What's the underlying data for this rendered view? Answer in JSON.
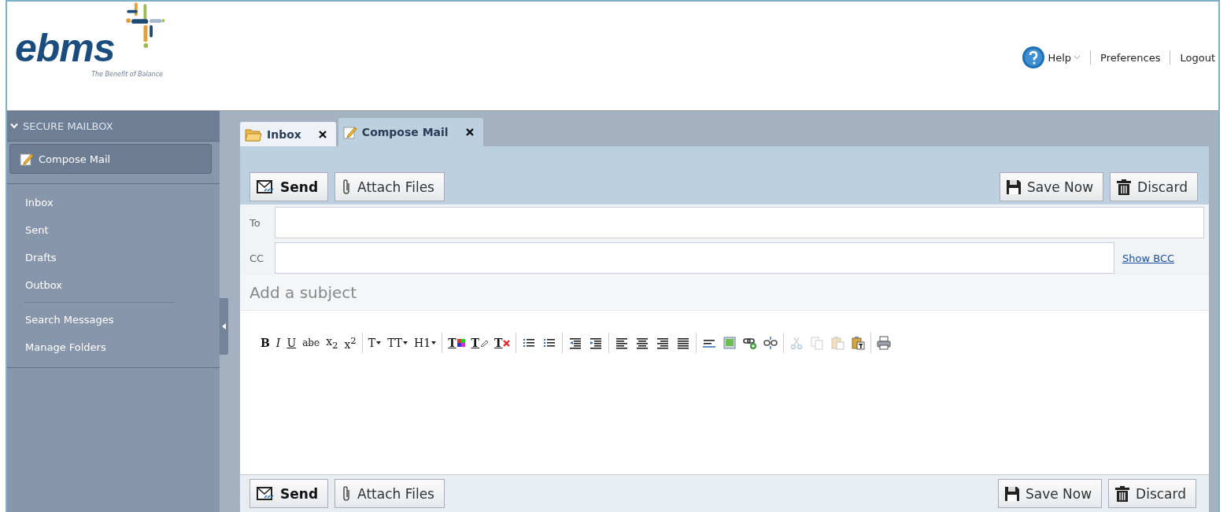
{
  "logo": {
    "name": "ebms",
    "tagline": "The Benefit of Balance"
  },
  "header_links": [
    {
      "kind": "help",
      "label": "Help"
    },
    {
      "kind": "link",
      "label": "Preferences"
    },
    {
      "kind": "link",
      "label": "Logout"
    }
  ],
  "sidebar": {
    "title": "SECURE MAILBOX",
    "expanded": true,
    "compose_button": "Compose Mail",
    "groups": [
      [
        {
          "label": "Inbox"
        },
        {
          "label": "Sent"
        },
        {
          "label": "Drafts"
        },
        {
          "label": "Outbox"
        }
      ],
      [
        {
          "label": "Search Messages"
        },
        {
          "label": "Manage Folders"
        }
      ]
    ]
  },
  "tabs": [
    {
      "label": "Inbox",
      "kind": "folder",
      "selected": false
    },
    {
      "label": "Compose Mail",
      "kind": "compose",
      "selected": true
    }
  ],
  "toolbars": [
    {
      "left": [
        {
          "label": "Send",
          "kind": "send"
        },
        {
          "label": "Attach Files",
          "kind": "attach"
        }
      ],
      "right": [
        {
          "label": "Save Now",
          "kind": "save"
        },
        {
          "label": "Discard",
          "kind": "discard"
        }
      ]
    },
    {
      "left": [
        {
          "label": "Send",
          "kind": "send"
        },
        {
          "label": "Attach Files",
          "kind": "attach"
        }
      ],
      "right": [
        {
          "label": "Save Now",
          "kind": "save"
        },
        {
          "label": "Discard",
          "kind": "discard"
        }
      ]
    }
  ],
  "to": {
    "label": "To"
  },
  "cc": {
    "label": "CC",
    "link": "Show BCC"
  },
  "subject": {
    "placeholder": "Add a subject"
  },
  "editor_tools": [
    [
      {
        "kind": "bold",
        "label": "B",
        "disabled": false
      },
      {
        "kind": "italic",
        "label": "I",
        "disabled": false
      },
      {
        "kind": "underline",
        "label": "U",
        "disabled": false
      },
      {
        "kind": "strike",
        "label": "abe",
        "disabled": false
      },
      {
        "kind": "letter",
        "label": "x$_{2}$",
        "disabled": false
      },
      {
        "kind": "letter",
        "label": "x$^{2}$",
        "disabled": false
      }
    ],
    [
      {
        "kind": "dropdown",
        "label": "T",
        "disabled": false
      },
      {
        "kind": "dropdown",
        "label": "TT",
        "disabled": false
      },
      {
        "kind": "dropdown",
        "label": "H1",
        "disabled": false
      }
    ],
    [
      {
        "kind": "text-color",
        "label": "T",
        "disabled": false
      },
      {
        "kind": "highlight",
        "label": "T",
        "disabled": false
      },
      {
        "kind": "clear-format",
        "label": "T",
        "disabled": false
      }
    ],
    [
      {
        "kind": "bullets",
        "disabled": false
      },
      {
        "kind": "numbers",
        "disabled": false
      }
    ],
    [
      {
        "kind": "outdent",
        "disabled": false
      },
      {
        "kind": "indent",
        "disabled": false
      }
    ],
    [
      {
        "kind": "align-left",
        "disabled": false
      },
      {
        "kind": "align-center",
        "disabled": false
      },
      {
        "kind": "align-right",
        "disabled": false
      },
      {
        "kind": "justify",
        "disabled": false
      }
    ],
    [
      {
        "kind": "rule",
        "disabled": false
      },
      {
        "kind": "image",
        "disabled": false
      },
      {
        "kind": "link",
        "disabled": false
      },
      {
        "kind": "unlink",
        "disabled": false
      }
    ],
    [
      {
        "kind": "cut",
        "disabled": true
      },
      {
        "kind": "copy",
        "disabled": true
      },
      {
        "kind": "paste",
        "disabled": true
      },
      {
        "kind": "paste-text",
        "disabled": false
      }
    ],
    [
      {
        "kind": "print",
        "disabled": false
      }
    ]
  ]
}
